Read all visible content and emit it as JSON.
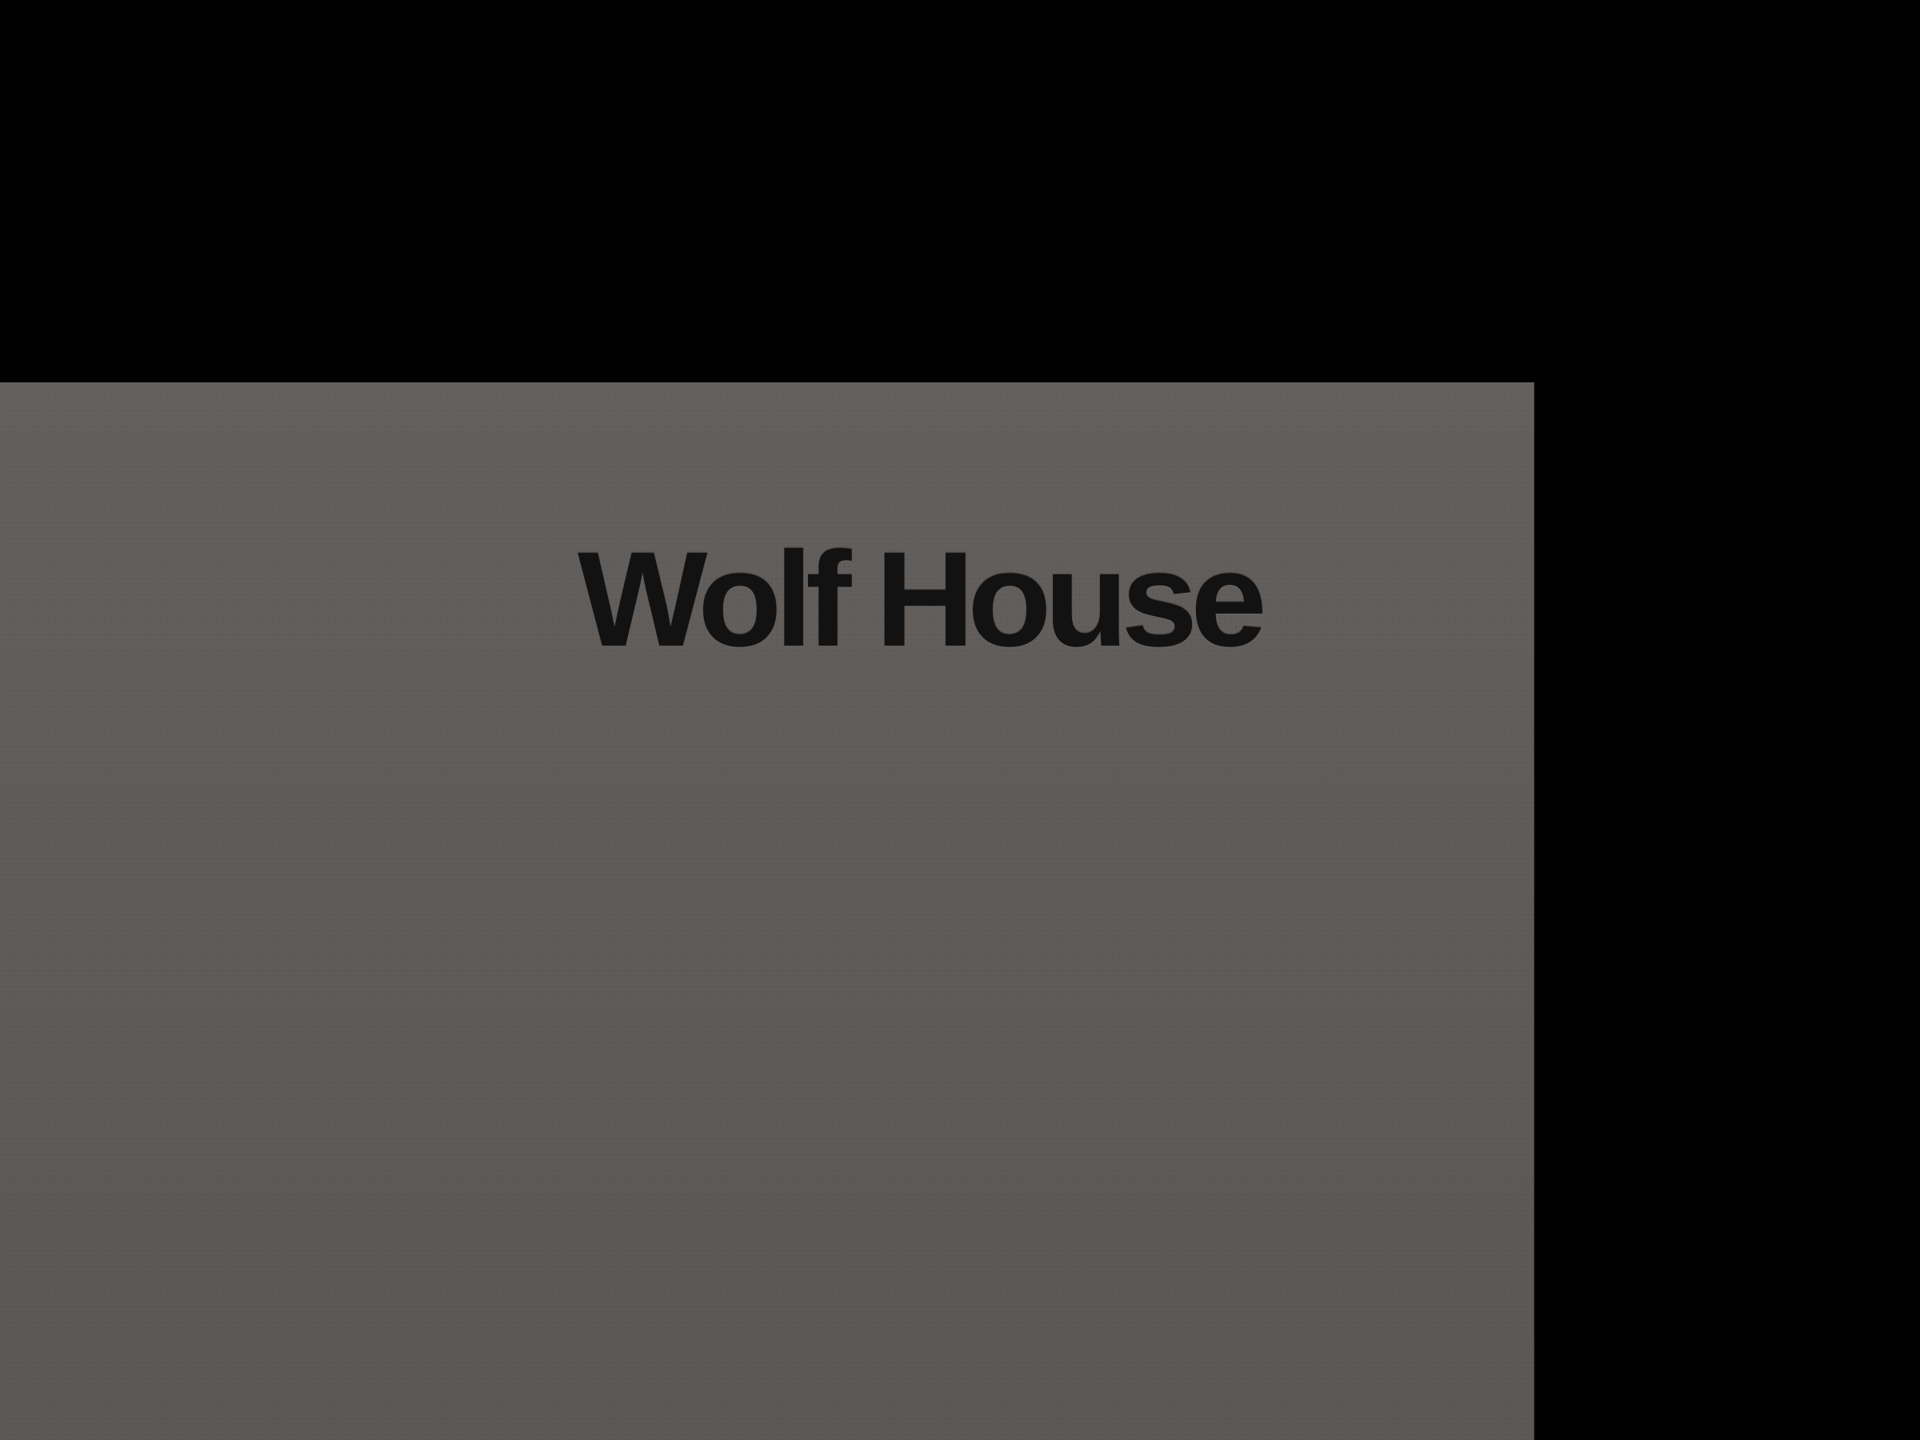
{
  "photo": {
    "background_color": "#000000",
    "paper_color": "#5f5c5a",
    "ink_color": "#121212"
  },
  "brand": {
    "wordmark": "Wolf House"
  }
}
